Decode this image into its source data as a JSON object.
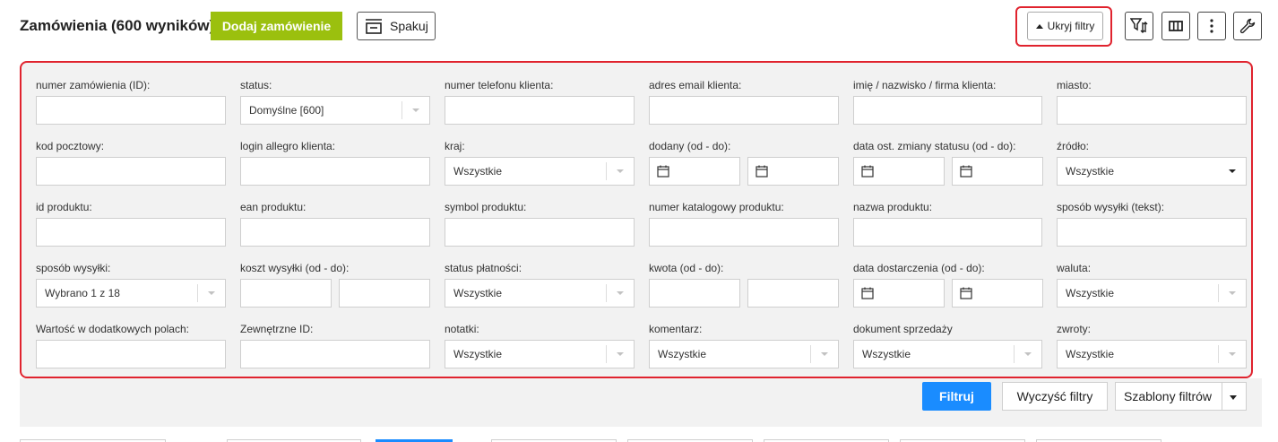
{
  "header": {
    "title": "Zamówienia (600 wyników)",
    "add_button": "Dodaj zamówienie",
    "pack_button": "Spakuj",
    "hide_filters_button": "Ukryj filtry"
  },
  "filters": {
    "row1": {
      "order_id": "numer zamówienia (ID):",
      "status": "status:",
      "status_value": "Domyślne [600]",
      "phone": "numer telefonu klienta:",
      "email": "adres email klienta:",
      "name": "imię / nazwisko / firma klienta:",
      "city": "miasto:"
    },
    "row2": {
      "postcode": "kod pocztowy:",
      "allegro_login": "login allegro klienta:",
      "country": "kraj:",
      "country_value": "Wszystkie",
      "added": "dodany (od - do):",
      "status_change": "data ost. zmiany statusu (od - do):",
      "source": "źródło:",
      "source_value": "Wszystkie"
    },
    "row3": {
      "product_id": "id produktu:",
      "ean": "ean produktu:",
      "symbol": "symbol produktu:",
      "catalog_number": "numer katalogowy produktu:",
      "product_name": "nazwa produktu:",
      "shipping_text": "sposób wysyłki (tekst):"
    },
    "row4": {
      "shipping": "sposób wysyłki:",
      "shipping_value": "Wybrano 1 z 18",
      "shipping_cost": "koszt wysyłki (od - do):",
      "payment_status": "status płatności:",
      "payment_status_value": "Wszystkie",
      "amount": "kwota (od - do):",
      "delivery_date": "data dostarczenia (od - do):",
      "currency": "waluta:",
      "currency_value": "Wszystkie"
    },
    "row5": {
      "extra_fields": "Wartość w dodatkowych polach:",
      "external_id": "Zewnętrzne ID:",
      "notes": "notatki:",
      "notes_value": "Wszystkie",
      "comment": "komentarz:",
      "comment_value": "Wszystkie",
      "sales_document": "dokument sprzedaży",
      "sales_document_value": "Wszystkie",
      "returns": "zwroty:",
      "returns_value": "Wszystkie"
    }
  },
  "actions": {
    "filter": "Filtruj",
    "clear": "Wyczyść filtry",
    "templates": "Szablony filtrów"
  },
  "colors": {
    "accent_green": "#9bc00e",
    "primary_blue": "#1a8cff",
    "highlight_red": "#e0232e"
  }
}
